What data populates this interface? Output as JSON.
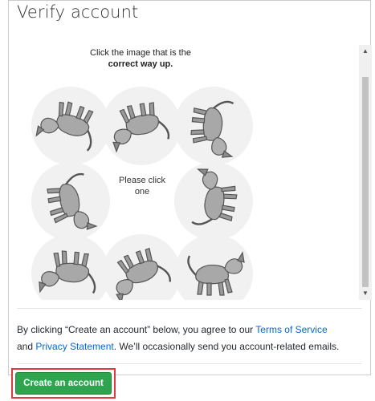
{
  "page": {
    "title": "Verify account"
  },
  "captcha": {
    "instruction_line1": "Click the image that is the",
    "instruction_line2": "correct way up.",
    "prompt_line1": "Please click",
    "prompt_line2": "one",
    "tile_rotations_deg": [
      200,
      170,
      95,
      80,
      0,
      280,
      185,
      160,
      0
    ]
  },
  "legal": {
    "prefix": "By clicking “Create an account” below, you agree to our ",
    "terms_link": "Terms of Service",
    "and_text": "and ",
    "privacy_link": "Privacy Statement",
    "suffix": ". We’ll occasionally send you account-related emails."
  },
  "actions": {
    "create_label": "Create an account"
  },
  "icons": {
    "scroll_up": "▲",
    "scroll_down": "▼"
  },
  "colors": {
    "primary_button": "#2ea44f",
    "link": "#0366d6",
    "highlight": "#e0393e"
  }
}
